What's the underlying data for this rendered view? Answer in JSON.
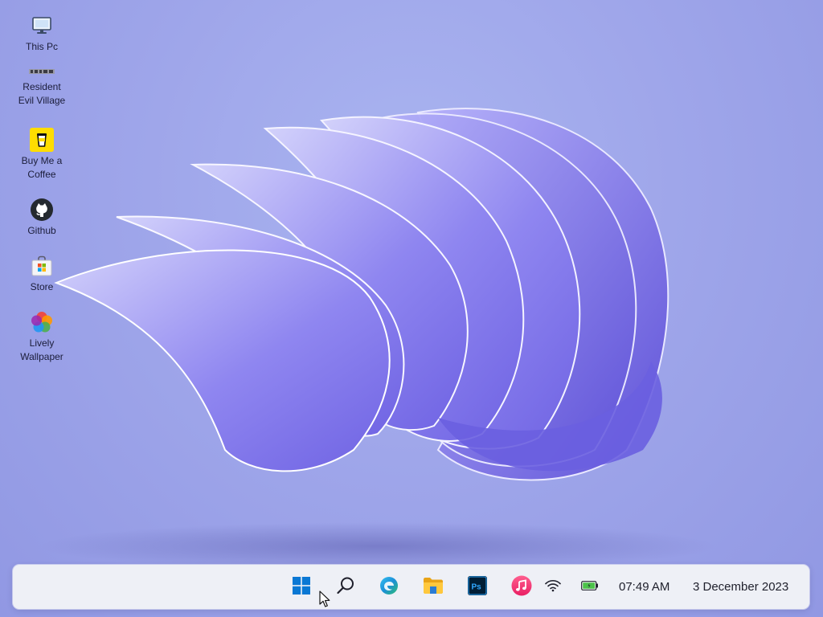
{
  "desktop": {
    "icons": [
      {
        "label": "This Pc",
        "icon": "computer-icon"
      },
      {
        "label": "Resident\nEvil Village",
        "icon": "resident-evil-village-icon"
      },
      {
        "label": "Buy Me a\nCoffee",
        "icon": "coffee-cup-icon"
      },
      {
        "label": "Github",
        "icon": "github-icon"
      },
      {
        "label": "Store",
        "icon": "store-icon"
      },
      {
        "label": "Lively\nWallpaper",
        "icon": "lively-wallpaper-icon"
      }
    ]
  },
  "taskbar": {
    "apps": [
      {
        "name": "Start",
        "icon": "windows-start-icon"
      },
      {
        "name": "Search",
        "icon": "search-icon"
      },
      {
        "name": "Microsoft Edge",
        "icon": "edge-icon"
      },
      {
        "name": "File Explorer",
        "icon": "folder-icon"
      },
      {
        "name": "Photoshop",
        "icon": "photoshop-icon"
      },
      {
        "name": "Music",
        "icon": "music-icon"
      }
    ],
    "tray": {
      "wifi_icon": "wifi-icon",
      "battery_icon": "battery-icon",
      "time": "07:49 AM",
      "date": "3 December 2023"
    }
  },
  "colors": {
    "wallpaper": "#9fa6ea",
    "taskbar": "#eef0f6",
    "accent": "#0a78d4"
  }
}
